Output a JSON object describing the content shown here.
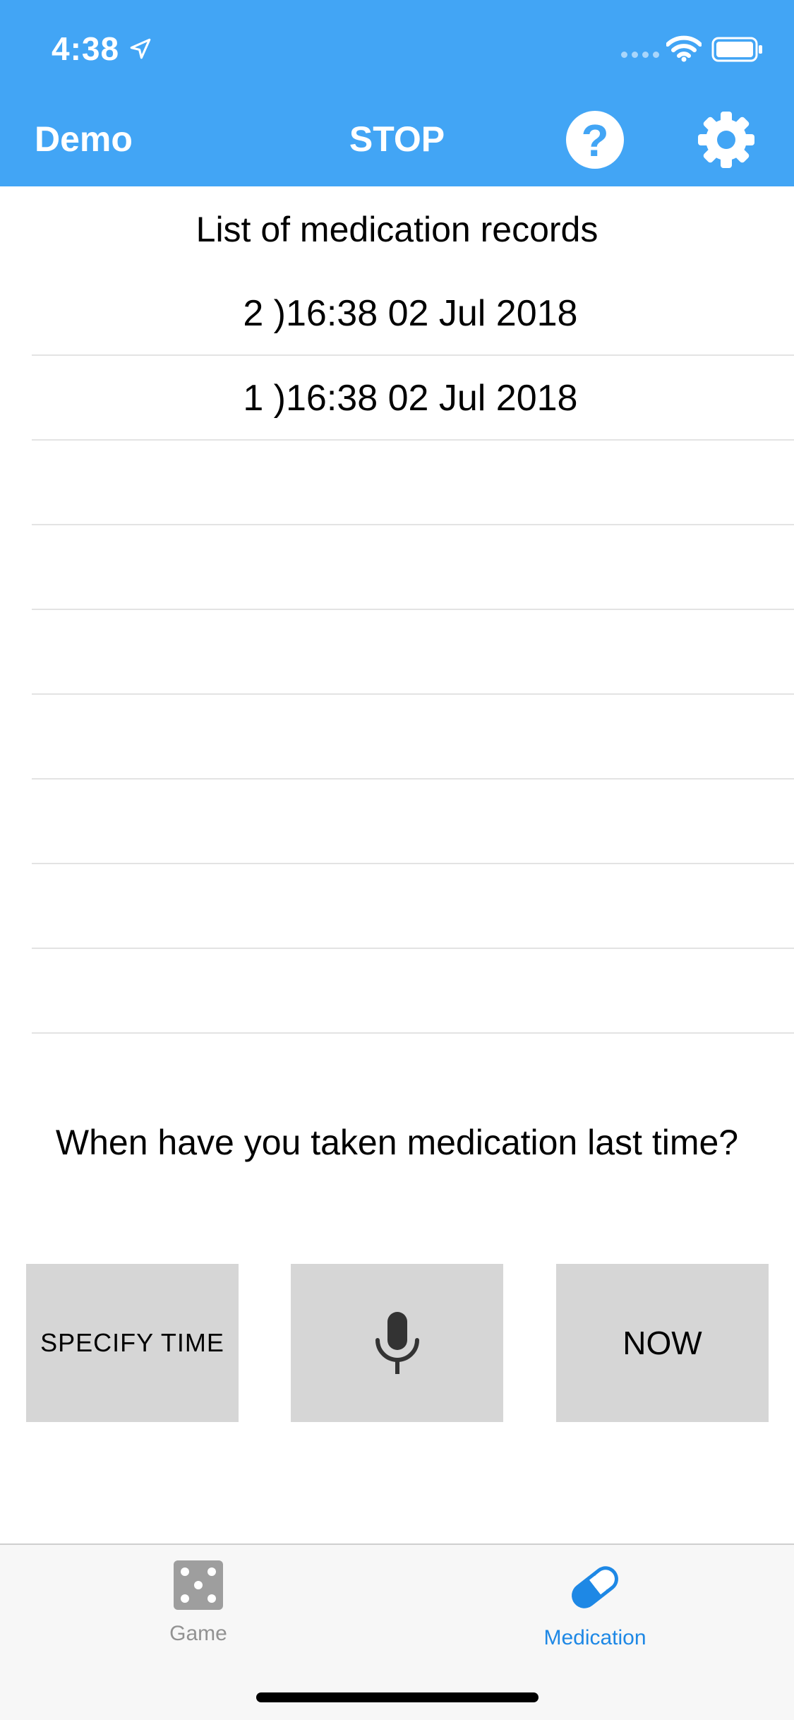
{
  "status_bar": {
    "time": "4:38",
    "location_icon": "location-arrow-icon",
    "wifi_icon": "wifi-icon",
    "battery_icon": "battery-icon"
  },
  "nav": {
    "left_label": "Demo",
    "title": "STOP",
    "help_icon": "question-circle-icon",
    "help_glyph": "?",
    "settings_icon": "gear-icon",
    "accent_color": "#42a5f5"
  },
  "records": {
    "title": "List of medication records",
    "items": [
      {
        "index": "2 )",
        "time": "16:38 02 Jul 2018"
      },
      {
        "index": "1 )",
        "time": "16:38 02 Jul 2018"
      }
    ],
    "empty_rows": 7
  },
  "prompt": {
    "question": "When have you taken medication last time?"
  },
  "actions": {
    "specify": "SPECIFY TIME",
    "voice_icon": "microphone-icon",
    "now": "NOW"
  },
  "tabbar": {
    "tabs": [
      {
        "label": "Game",
        "icon": "dice-icon",
        "active": false
      },
      {
        "label": "Medication",
        "icon": "pill-icon",
        "active": true
      }
    ],
    "active_color": "#1e88e5",
    "inactive_color": "#929292"
  }
}
